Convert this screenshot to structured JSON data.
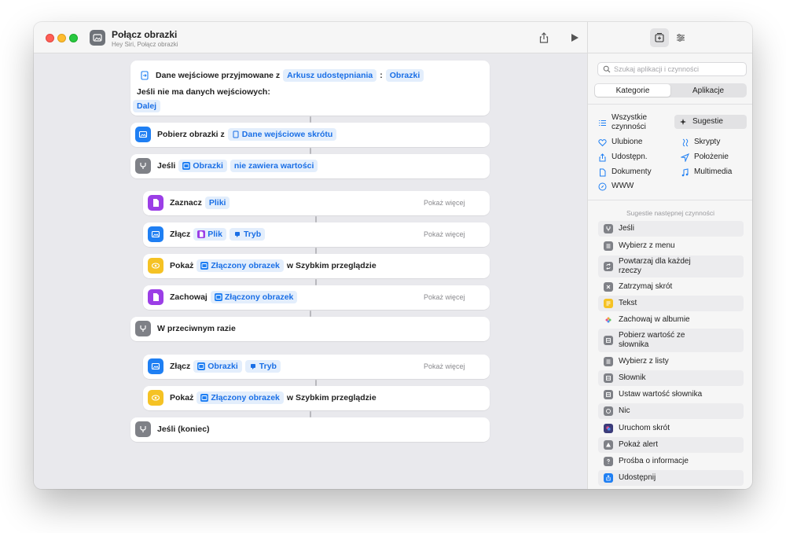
{
  "window": {
    "title": "Połącz obrazki",
    "subtitle": "Hey Siri, Połącz obrazki"
  },
  "colors": {
    "accent": "#1a6fe6",
    "token_bg": "#e3eefc",
    "blue_icon": "#1f7ff3",
    "purple_icon": "#9b3ee6",
    "yellow_icon": "#f5c224",
    "gray_icon": "#7f8187"
  },
  "editor": {
    "input_block": {
      "label": "Dane wejściowe przyjmowane z",
      "source": "Arkusz udostępniania",
      "separator": ":",
      "type": "Obrazki",
      "if_none_label": "Jeśli nie ma danych wejściowych:",
      "if_none_action": "Dalej"
    },
    "get_images": {
      "label": "Pobierz obrazki z",
      "token": "Dane wejściowe skrótu"
    },
    "if_block": {
      "label": "Jeśli",
      "token": "Obrazki",
      "condition": "nie zawiera wartości"
    },
    "select": {
      "label": "Zaznacz",
      "token": "Pliki",
      "more": "Pokaż więcej"
    },
    "merge1": {
      "label": "Złącz",
      "token1": "Plik",
      "token2": "Tryb",
      "more": "Pokaż więcej"
    },
    "show1": {
      "label": "Pokaż",
      "token": "Złączony obrazek",
      "suffix": "w Szybkim przeglądzie"
    },
    "save": {
      "label": "Zachowaj",
      "token": "Złączony obrazek",
      "more": "Pokaż więcej"
    },
    "otherwise": {
      "label": "W przeciwnym razie"
    },
    "merge2": {
      "label": "Złącz",
      "token1": "Obrazki",
      "token2": "Tryb",
      "more": "Pokaż więcej"
    },
    "show2": {
      "label": "Pokaż",
      "token": "Złączony obrazek",
      "suffix": "w Szybkim przeglądzie"
    },
    "end_if": {
      "label": "Jeśli (koniec)"
    }
  },
  "sidebar": {
    "search_placeholder": "Szukaj aplikacji i czynności",
    "segments": [
      "Kategorie",
      "Aplikacje"
    ],
    "categories": [
      {
        "label": "Wszystkie czynności",
        "icon": "list-icon"
      },
      {
        "label": "Sugestie",
        "icon": "sparkle-icon",
        "selected": true
      },
      {
        "label": "Ulubione",
        "icon": "heart-icon"
      },
      {
        "label": "Skrypty",
        "icon": "scripts-icon"
      },
      {
        "label": "Udostępn.",
        "icon": "share-icon"
      },
      {
        "label": "Położenie",
        "icon": "location-icon"
      },
      {
        "label": "Dokumenty",
        "icon": "document-icon"
      },
      {
        "label": "Multimedia",
        "icon": "music-icon"
      },
      {
        "label": "WWW",
        "icon": "compass-icon"
      }
    ],
    "suggestions_title": "Sugestie następnej czynności",
    "suggestions": [
      {
        "label": "Jeśli",
        "color": "#7f8187",
        "icon": "branch-icon"
      },
      {
        "label": "Wybierz z menu",
        "color": "#7f8187",
        "icon": "menu-icon"
      },
      {
        "label": "Powtarzaj dla każdej rzeczy",
        "color": "#7f8187",
        "icon": "repeat-icon"
      },
      {
        "label": "Zatrzymaj skrót",
        "color": "#7f8187",
        "icon": "stop-icon"
      },
      {
        "label": "Tekst",
        "color": "#f5c224",
        "icon": "text-icon"
      },
      {
        "label": "Zachowaj w albumie",
        "color": "#ffffff",
        "icon": "photos-icon"
      },
      {
        "label": "Pobierz wartość ze słownika",
        "color": "#7f8187",
        "icon": "dictionary-icon"
      },
      {
        "label": "Wybierz z listy",
        "color": "#7f8187",
        "icon": "list-icon"
      },
      {
        "label": "Słownik",
        "color": "#7f8187",
        "icon": "dictionary-icon"
      },
      {
        "label": "Ustaw wartość słownika",
        "color": "#7f8187",
        "icon": "dictionary-icon"
      },
      {
        "label": "Nic",
        "color": "#7f8187",
        "icon": "nothing-icon"
      },
      {
        "label": "Uruchom skrót",
        "color": "#3c3c7a",
        "icon": "shortcuts-icon"
      },
      {
        "label": "Pokaż alert",
        "color": "#7f8187",
        "icon": "alert-icon"
      },
      {
        "label": "Prośba o informacje",
        "color": "#7f8187",
        "icon": "question-icon"
      },
      {
        "label": "Udostępnij",
        "color": "#1f7ff3",
        "icon": "share-icon"
      }
    ]
  }
}
